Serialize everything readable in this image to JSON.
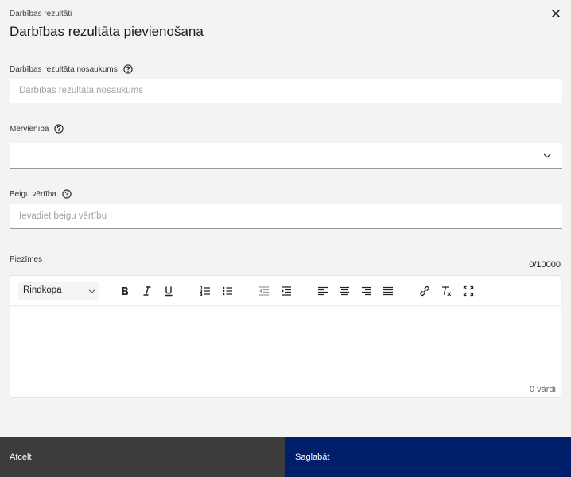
{
  "header": {
    "breadcrumb": "Darbības rezultāti",
    "title": "Darbības rezultāta pievienošana"
  },
  "fields": {
    "name": {
      "label": "Darbības rezultāta nosaukums",
      "placeholder": "Darbības rezultāta nosaukums",
      "value": ""
    },
    "unit": {
      "label": "Mērvienība",
      "value": ""
    },
    "final_value": {
      "label": "Beigu vērtība",
      "placeholder": "Ievadiet beigu vērtību",
      "value": ""
    },
    "notes": {
      "label": "Piezīmes",
      "counter": "0/10000"
    }
  },
  "editor": {
    "format_selected": "Rindkopa",
    "toolbar_icons": [
      "bold-icon",
      "italic-icon",
      "underline-icon",
      "ordered-list-icon",
      "bullet-list-icon",
      "outdent-icon",
      "indent-icon",
      "align-left-icon",
      "align-center-icon",
      "align-right-icon",
      "align-justify-icon",
      "link-icon",
      "clear-format-icon",
      "fullscreen-icon"
    ],
    "word_count": "0 vārdi"
  },
  "footer": {
    "cancel_label": "Atcelt",
    "save_label": "Saglabāt"
  },
  "colors": {
    "background": "#f3f3f3",
    "cancel_bg": "#3c3c3c",
    "save_bg": "#001f6b"
  }
}
